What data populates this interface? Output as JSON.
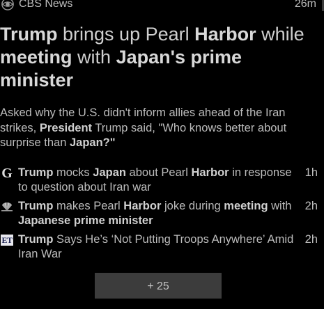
{
  "card": {
    "source": {
      "name": "CBS News",
      "time": "26m",
      "icon": "cbs-eye-logo"
    },
    "headline": [
      {
        "text": "Trump",
        "bold": true
      },
      {
        "text": " brings up Pearl ",
        "bold": false
      },
      {
        "text": "Harbor",
        "bold": true
      },
      {
        "text": " while ",
        "bold": false
      },
      {
        "text": "meeting",
        "bold": true
      },
      {
        "text": " with ",
        "bold": false
      },
      {
        "text": "Japan's prime minister",
        "bold": true
      }
    ],
    "summary": [
      {
        "text": "Asked why the U.S. didn't inform allies ahead of the Iran strikes, ",
        "bold": false
      },
      {
        "text": "President",
        "bold": true
      },
      {
        "text": " Trump said, \"Who knows better about surprise than ",
        "bold": false
      },
      {
        "text": "Japan?\"",
        "bold": true
      }
    ],
    "related": [
      {
        "icon": "g-logo-icon",
        "icon_text": "G",
        "time": "1h",
        "segments": [
          {
            "text": "Trump",
            "bold": true
          },
          {
            "text": " mocks ",
            "bold": false
          },
          {
            "text": "Japan",
            "bold": true
          },
          {
            "text": " about Pearl ",
            "bold": false
          },
          {
            "text": "Harbor",
            "bold": true
          },
          {
            "text": " in response to question about Iran war",
            "bold": false
          }
        ]
      },
      {
        "icon": "nbc-peacock-icon",
        "icon_text": "",
        "time": "2h",
        "segments": [
          {
            "text": "Trump",
            "bold": true
          },
          {
            "text": " makes Pearl ",
            "bold": false
          },
          {
            "text": "Harbor",
            "bold": true
          },
          {
            "text": " joke during ",
            "bold": false
          },
          {
            "text": "meeting",
            "bold": true
          },
          {
            "text": " with ",
            "bold": false
          },
          {
            "text": "Japanese",
            "bold": true
          },
          {
            "text": " ",
            "bold": false
          },
          {
            "text": "prime",
            "bold": true
          },
          {
            "text": " ",
            "bold": false
          },
          {
            "text": "minister",
            "bold": true
          }
        ]
      },
      {
        "icon": "et-logo-icon",
        "icon_text": "ET",
        "time": "2h",
        "segments": [
          {
            "text": "Trump",
            "bold": true
          },
          {
            "text": " Says He’s ‘Not Putting Troops Anywhere’ Amid Iran War",
            "bold": false
          }
        ]
      }
    ],
    "more_button": "+ 25"
  },
  "colors": {
    "background": "#000000",
    "text": "#c8c8c8",
    "button_bg": "#3c3c3c"
  }
}
